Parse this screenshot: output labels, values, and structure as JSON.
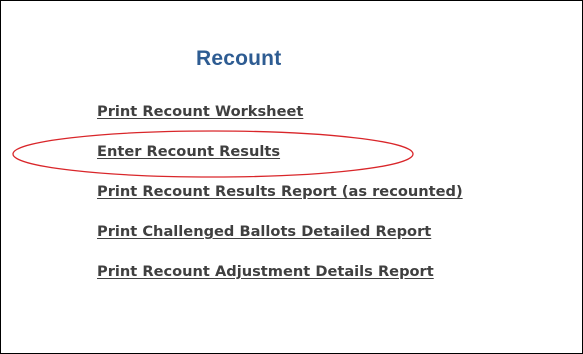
{
  "section": {
    "title": "Recount"
  },
  "menu": {
    "items": [
      {
        "label": "Print Recount Worksheet"
      },
      {
        "label": "Enter Recount Results"
      },
      {
        "label": "Print Recount Results Report (as recounted)"
      },
      {
        "label": "Print Challenged Ballots Detailed Report"
      },
      {
        "label": "Print Recount Adjustment Details Report"
      }
    ]
  },
  "colors": {
    "title": "#2e5c92",
    "link": "#404040",
    "highlight_ellipse": "#d9262a",
    "border": "#000000"
  }
}
